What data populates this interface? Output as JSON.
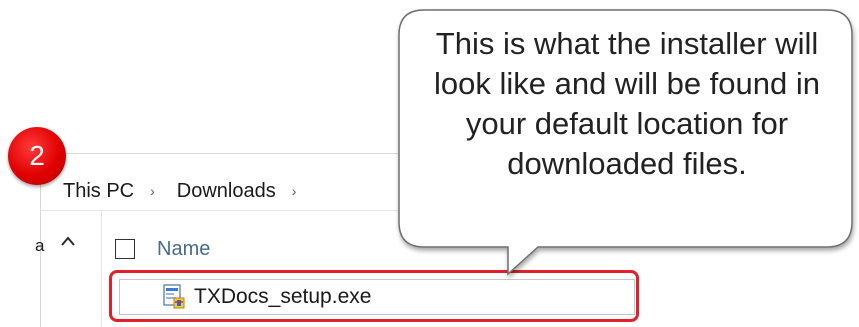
{
  "explorer": {
    "breadcrumb": [
      "This PC",
      "Downloads"
    ],
    "breadcrumb_separator": "›",
    "nav_pane_truncated_text": "a",
    "column_header": "Name",
    "file": {
      "name": "TXDocs_setup.exe",
      "icon": "installer-exe-icon"
    }
  },
  "step_badge": {
    "number": "2",
    "color": "#e00000"
  },
  "callout": {
    "text": "This is what the installer will look like and will be found in your default location for downloaded files."
  },
  "highlight_color": "#e0202a"
}
